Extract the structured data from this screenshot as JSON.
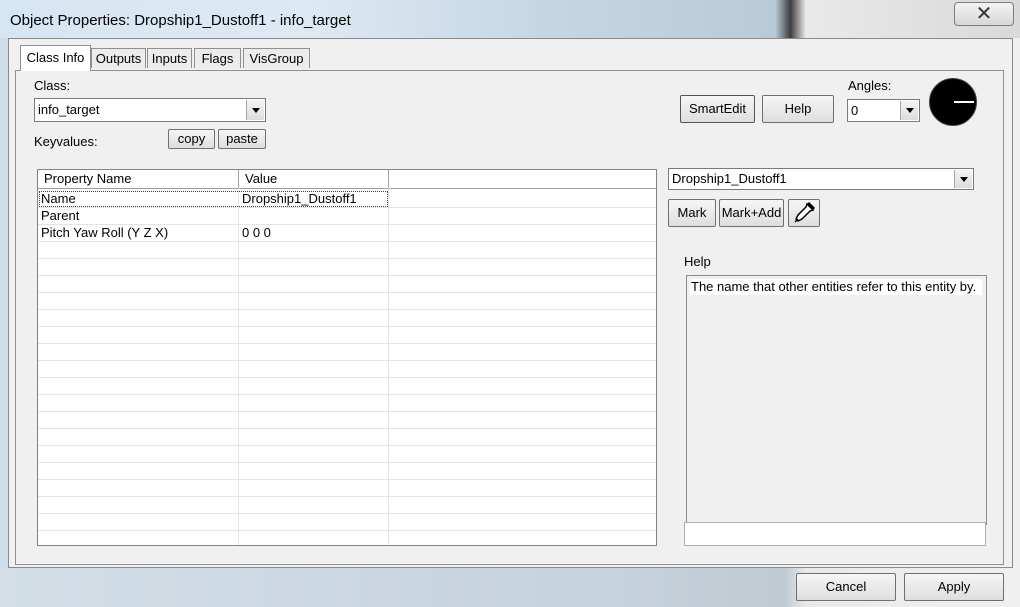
{
  "window": {
    "title": "Object Properties: Dropship1_Dustoff1 - info_target",
    "close_glyph": "✕"
  },
  "tabs": [
    {
      "label": "Class Info",
      "active": true
    },
    {
      "label": "Outputs",
      "active": false
    },
    {
      "label": "Inputs",
      "active": false
    },
    {
      "label": "Flags",
      "active": false
    },
    {
      "label": "VisGroup",
      "active": false
    }
  ],
  "class_info": {
    "class_label": "Class:",
    "class_value": "info_target",
    "keyvalues_label": "Keyvalues:",
    "copy_label": "copy",
    "paste_label": "paste",
    "smartedit_label": "SmartEdit",
    "help_button_label": "Help",
    "angles_label": "Angles:",
    "angles_value": "0",
    "angle_dial_icon": "angle-dial-icon"
  },
  "grid": {
    "columns": [
      "Property Name",
      "Value"
    ],
    "rows": [
      {
        "name": "Name",
        "value": "Dropship1_Dustoff1",
        "selected": true
      },
      {
        "name": "Parent",
        "value": "",
        "selected": false
      },
      {
        "name": "Pitch Yaw Roll (Y Z X)",
        "value": "0 0 0",
        "selected": false
      }
    ]
  },
  "target": {
    "value": "Dropship1_Dustoff1",
    "mark_label": "Mark",
    "markadd_label": "Mark+Add",
    "picker_icon": "eyedropper-icon"
  },
  "help_panel": {
    "label": "Help",
    "text": "The name that other entities refer to this entity by."
  },
  "footer": {
    "cancel_label": "Cancel",
    "apply_label": "Apply"
  },
  "colors": {
    "dialog_bg": "#f0f0f0",
    "selection_outline": "#3b3b3b"
  }
}
